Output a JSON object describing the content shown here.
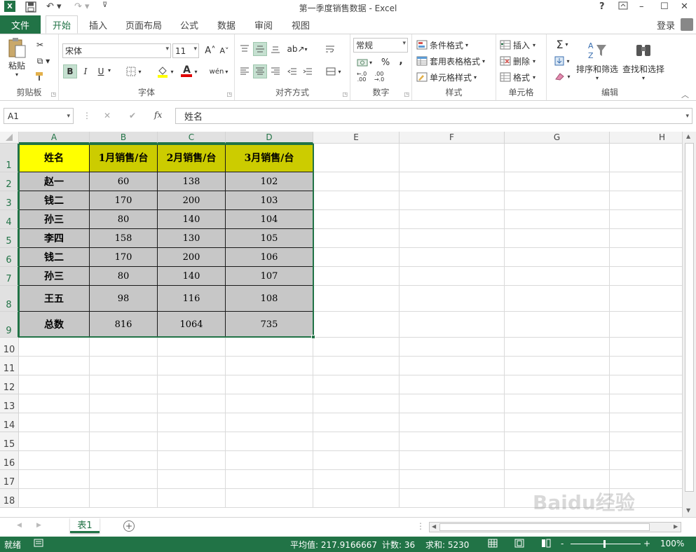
{
  "window": {
    "title": "第一季度销售数据 - Excel",
    "help": "?",
    "minimize": "–",
    "maximize": "☐",
    "close": "✕"
  },
  "tabs": {
    "file": "文件",
    "items": [
      "开始",
      "插入",
      "页面布局",
      "公式",
      "数据",
      "审阅",
      "视图"
    ],
    "active": "开始",
    "login": "登录"
  },
  "ribbon": {
    "clipboard": {
      "paste": "粘贴",
      "label": "剪贴板"
    },
    "font": {
      "name": "宋体",
      "size": "11",
      "bold": "B",
      "italic": "I",
      "underline": "U",
      "grow": "A˄",
      "shrink": "A˅",
      "color_a": "A",
      "wen": "wén",
      "label": "字体"
    },
    "align": {
      "label": "对齐方式"
    },
    "number": {
      "format": "常规",
      "percent": "%",
      "comma": ",",
      "label": "数字"
    },
    "styles": {
      "cond": "条件格式",
      "table": "套用表格格式",
      "cell": "单元格样式",
      "label": "样式"
    },
    "cells": {
      "insert": "插入",
      "delete": "删除",
      "format": "格式",
      "label": "单元格"
    },
    "editing": {
      "sort": "排序和筛选",
      "find": "查找和选择",
      "label": "编辑"
    }
  },
  "formula_bar": {
    "name_box": "A1",
    "fx": "fx",
    "cancel": "✕",
    "enter": "✔",
    "content": "姓名"
  },
  "grid": {
    "columns": [
      "A",
      "B",
      "C",
      "D",
      "E",
      "F",
      "G",
      "H"
    ],
    "rows": [
      "1",
      "2",
      "3",
      "4",
      "5",
      "6",
      "7",
      "8",
      "9",
      "10",
      "11",
      "12",
      "13",
      "14",
      "15",
      "16",
      "17",
      "18"
    ],
    "headers": [
      "姓名",
      "1月销售/台",
      "2月销售/台",
      "3月销售/台"
    ],
    "data": [
      [
        "赵一",
        "60",
        "138",
        "102"
      ],
      [
        "钱二",
        "170",
        "200",
        "103"
      ],
      [
        "孙三",
        "80",
        "140",
        "104"
      ],
      [
        "李四",
        "158",
        "130",
        "105"
      ],
      [
        "钱二",
        "170",
        "200",
        "106"
      ],
      [
        "孙三",
        "80",
        "140",
        "107"
      ],
      [
        "王五",
        "98",
        "116",
        "108"
      ],
      [
        "总数",
        "816",
        "1064",
        "735"
      ]
    ]
  },
  "sheets": {
    "active": "表1",
    "add": "+"
  },
  "status": {
    "ready": "就绪",
    "average": "平均值: 217.9166667",
    "count": "计数: 36",
    "sum": "求和: 5230",
    "zoom": "100%",
    "minus": "-",
    "plus": "+"
  },
  "watermark": "Baidu经验",
  "colors": {
    "excel_green": "#217346",
    "header_yellow": "#ffff00",
    "header_olive": "#cccc00",
    "data_gray": "#c7c7c7"
  }
}
